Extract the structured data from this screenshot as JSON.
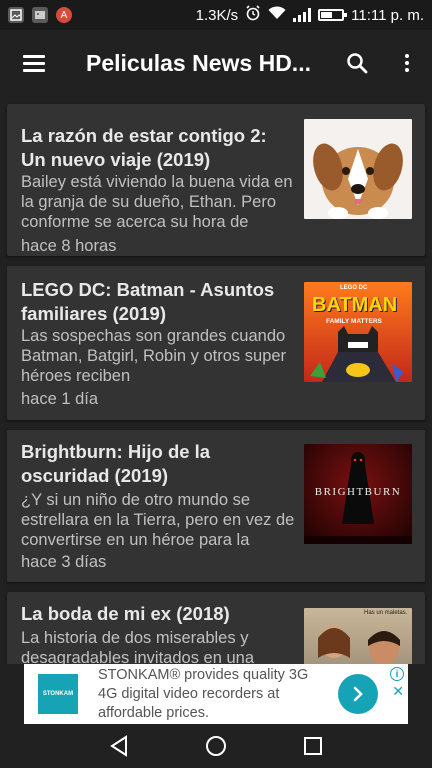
{
  "status_bar": {
    "speed": "1.3K/s",
    "time": "11:11 p. m.",
    "notification_icons": [
      "image-icon",
      "photo-icon",
      "account-icon"
    ],
    "notif_letter": "A",
    "battery_level": 0.6
  },
  "app_bar": {
    "title": "Peliculas News HD...",
    "menu_icon": "hamburger-menu-icon",
    "search_icon": "search-icon",
    "more_icon": "more-vert-icon"
  },
  "feed": [
    {
      "title": "La razón de estar contigo 2: Un nuevo viaje (2019)",
      "description": "Bailey está viviendo la buena vida en la granja de su dueño, Ethan. Pero conforme se acerca su hora de",
      "time": "hace 8 horas",
      "thumb": "dog-poster"
    },
    {
      "title": "LEGO DC: Batman - Asuntos familiares (2019)",
      "description": "Las sospechas son grandes cuando Batman, Batgirl, Robin y otros super héroes reciben",
      "time": "hace 1 día",
      "thumb": "batman-poster",
      "thumb_text": "BATMAN",
      "thumb_sub": "FAMILY MATTERS",
      "thumb_brand": "LEGO DC"
    },
    {
      "title": "Brightburn: Hijo de la oscuridad (2019)",
      "description": "¿Y si un niño de otro mundo se estrellara en la Tierra, pero en vez de convertirse en un héroe para la",
      "time": "hace 3 días",
      "thumb": "brightburn-poster",
      "thumb_text": "BRIGHTBURN"
    },
    {
      "title": "La boda de mi ex (2018)",
      "description": "La historia de dos miserables y desagradables invitados en una",
      "time": "",
      "thumb": "wedding-poster",
      "thumb_text": "Has un maletas."
    }
  ],
  "ad": {
    "logo_text": "STONKAM",
    "text": "STONKAM® provides quality 3G 4G digital video recorders at affordable prices.",
    "info": "i",
    "close": "✕"
  },
  "colors": {
    "background": "#212121",
    "card": "#333333",
    "ad_accent": "#16a3b6"
  }
}
